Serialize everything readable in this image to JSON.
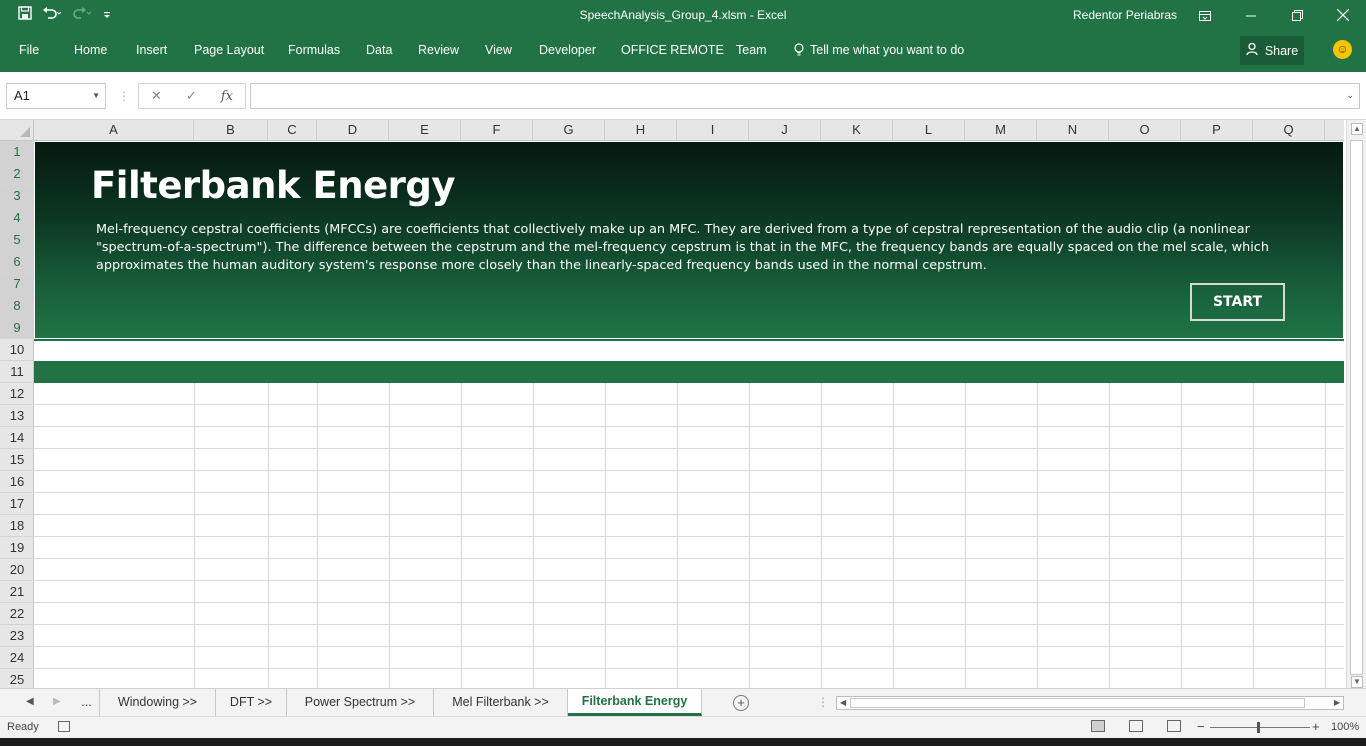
{
  "window": {
    "title": "SpeechAnalysis_Group_4.xlsm  -  Excel",
    "user": "Redentor Periabras",
    "qat": {
      "save_icon": "save-icon",
      "undo_icon": "undo-icon",
      "redo_icon": "redo-icon",
      "customize_icon": "customize-icon"
    }
  },
  "ribbon": {
    "tabs": [
      "File",
      "Home",
      "Insert",
      "Page Layout",
      "Formulas",
      "Data",
      "Review",
      "View",
      "Developer",
      "OFFICE REMOTE",
      "Team"
    ],
    "tell_me": "Tell me what you want to do",
    "share": "Share"
  },
  "formula_bar": {
    "name_box": "A1",
    "fx": "fx",
    "value": ""
  },
  "columns": [
    "A",
    "B",
    "C",
    "D",
    "E",
    "F",
    "G",
    "H",
    "I",
    "J",
    "K",
    "L",
    "M",
    "N",
    "O",
    "P",
    "Q"
  ],
  "rows": [
    "1",
    "2",
    "3",
    "4",
    "5",
    "6",
    "7",
    "8",
    "9",
    "10",
    "11",
    "12",
    "13",
    "14",
    "15",
    "16",
    "17",
    "18",
    "19",
    "20",
    "21",
    "22",
    "23",
    "24",
    "25"
  ],
  "banner": {
    "title": "Filterbank Energy",
    "description": "Mel-frequency cepstral coefficients (MFCCs) are coefficients that collectively make up an MFC. They are derived from a type of cepstral representation of the audio clip (a nonlinear \"spectrum-of-a-spectrum\"). The difference between the cepstrum and the mel-frequency cepstrum is that in the MFC, the frequency bands are equally spaced on the mel scale, which approximates the human auditory system's response more closely than the linearly-spaced frequency bands used in the normal cepstrum.",
    "button": "START"
  },
  "sheet_tabs": {
    "ellipsis": "...",
    "tabs": [
      "Windowing >>",
      "DFT >>",
      "Power Spectrum >>",
      "Mel Filterbank >>",
      "Filterbank Energy"
    ],
    "active": "Filterbank Energy"
  },
  "status": {
    "ready": "Ready",
    "zoom": "100%"
  },
  "colors": {
    "accent": "#217346"
  }
}
